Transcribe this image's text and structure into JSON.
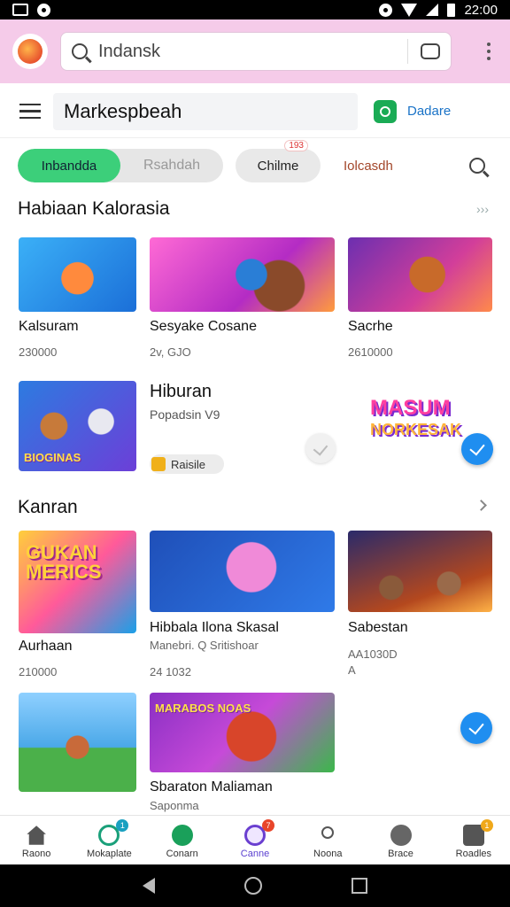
{
  "status": {
    "time": "22:00"
  },
  "browser": {
    "url": "Indansk"
  },
  "header": {
    "title": "Markespbeah",
    "link": "Dadare"
  },
  "tabs": {
    "active": "Inbandda",
    "inactive": "Rsahdah",
    "pill": "Chilme",
    "pill_badge": "193",
    "plain": "Iolcasdh"
  },
  "section1": {
    "title": "Habiaan Kalorasia",
    "more": "›››",
    "items": [
      {
        "name": "Kalsuram",
        "sub": "230000"
      },
      {
        "name": "Sesyake Cosane",
        "sub": "2v, GJO"
      },
      {
        "name": "Sacrhe",
        "sub": "2610000"
      }
    ]
  },
  "feature": {
    "title": "Hiburan",
    "sub": "Popadsin V9",
    "chip": "Raisile",
    "thumb_caption": "BIOGINAS",
    "logo_line1": "MASUM",
    "logo_line2": "NORKESAK"
  },
  "section2": {
    "title": "Kanran",
    "thumb_caption": "GUKAN MERICS",
    "items": [
      {
        "name": "Aurhaan",
        "sub": "210000"
      },
      {
        "name": "Hibbala Ilona Skasal",
        "sub": "Manebri. Q Sritishoar",
        "sub2": "24 1032"
      },
      {
        "name": "Sabestan",
        "sub": "AA1030D",
        "sub2": "A"
      }
    ],
    "row2": [
      {
        "name": "Sbaraton Maliaman",
        "sub": "Saponma",
        "thumb_caption": "MARABOS NOAS"
      }
    ]
  },
  "bottom_nav": [
    {
      "label": "Raono",
      "icon": "home-icon",
      "badge": ""
    },
    {
      "label": "Mokaplate",
      "icon": "ring-icon",
      "badge": "1"
    },
    {
      "label": "Conarn",
      "icon": "sync-icon",
      "badge": ""
    },
    {
      "label": "Canne",
      "icon": "gamepad-icon",
      "badge": "7"
    },
    {
      "label": "Noona",
      "icon": "person-icon",
      "badge": ""
    },
    {
      "label": "Brace",
      "icon": "shield-icon",
      "badge": ""
    },
    {
      "label": "Roadles",
      "icon": "bag-icon",
      "badge": "1"
    }
  ],
  "colors": {
    "accent_green": "#3ccf7a",
    "browser_bar": "#f5cbe9",
    "link_blue": "#1a73c7",
    "fab_blue": "#1f8ef0"
  }
}
